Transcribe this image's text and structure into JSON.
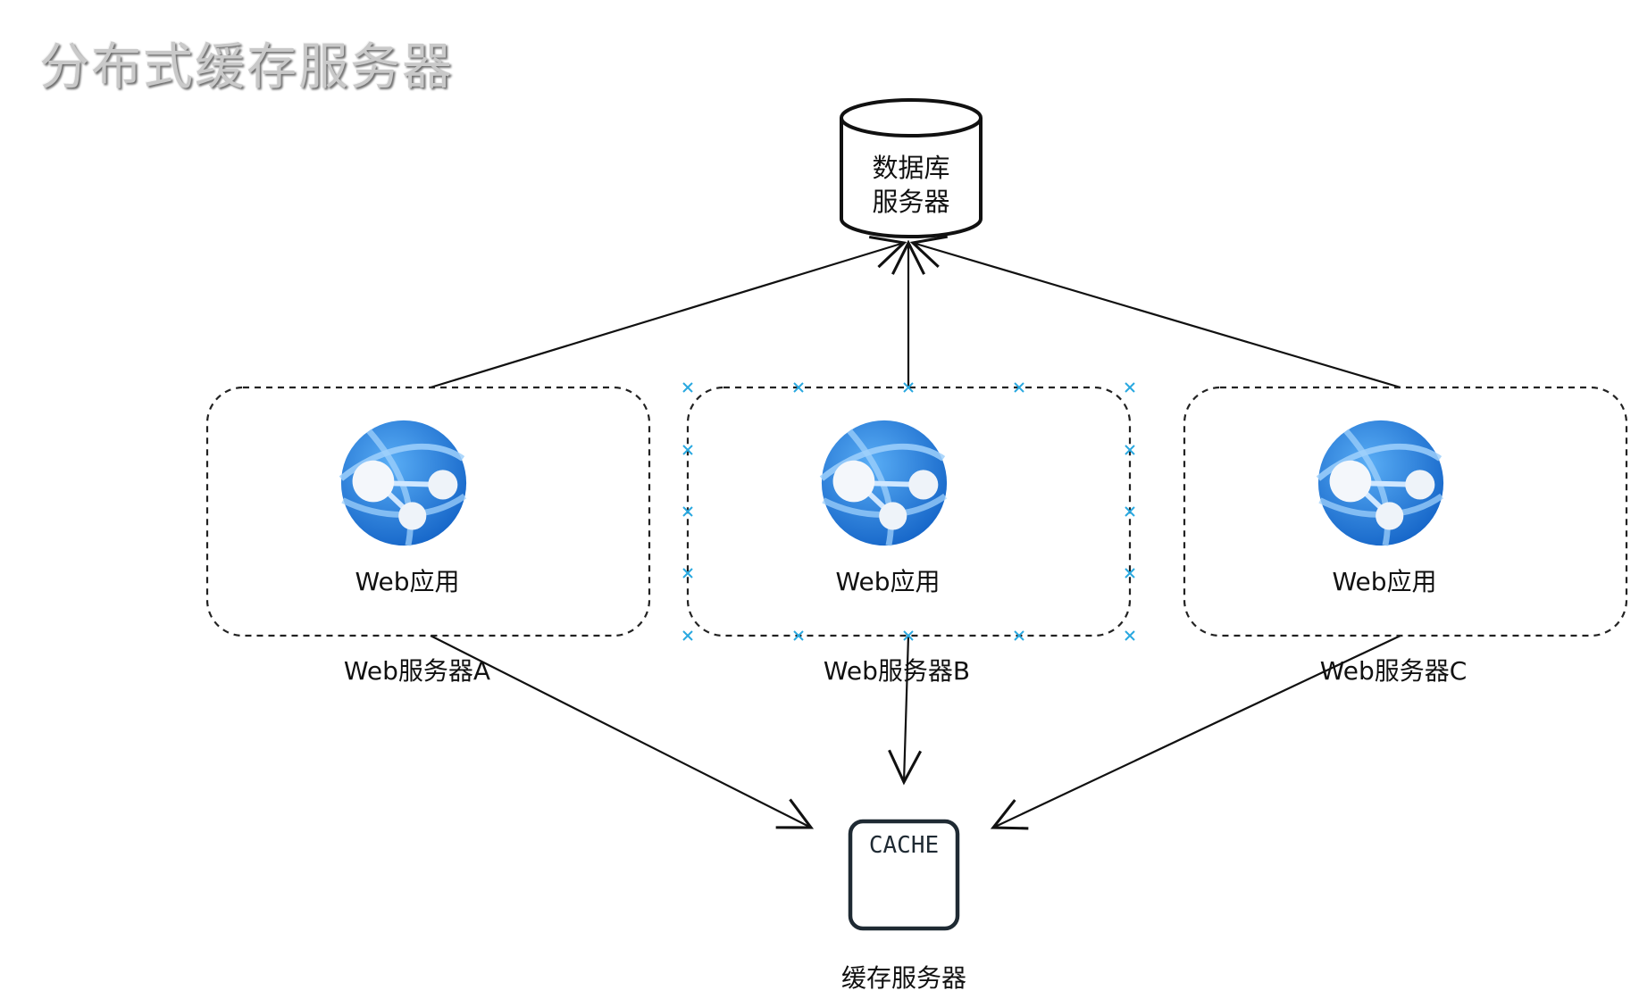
{
  "title": "分布式缓存服务器",
  "database": {
    "line1": "数据库",
    "line2": "服务器"
  },
  "web_servers": [
    {
      "app_label": "Web应用",
      "server_label": "Web服务器A",
      "icon": "web-app-globe-icon"
    },
    {
      "app_label": "Web应用",
      "server_label": "Web服务器B",
      "icon": "web-app-globe-icon"
    },
    {
      "app_label": "Web应用",
      "server_label": "Web服务器C",
      "icon": "web-app-globe-icon"
    }
  ],
  "cache": {
    "badge": "CACHE",
    "label": "缓存服务器"
  },
  "colors": {
    "globe_outer": "#1e73d2",
    "globe_inner": "#3b96ee",
    "selection_handle": "#29a8e0",
    "title_text": "#c9c9c9"
  }
}
